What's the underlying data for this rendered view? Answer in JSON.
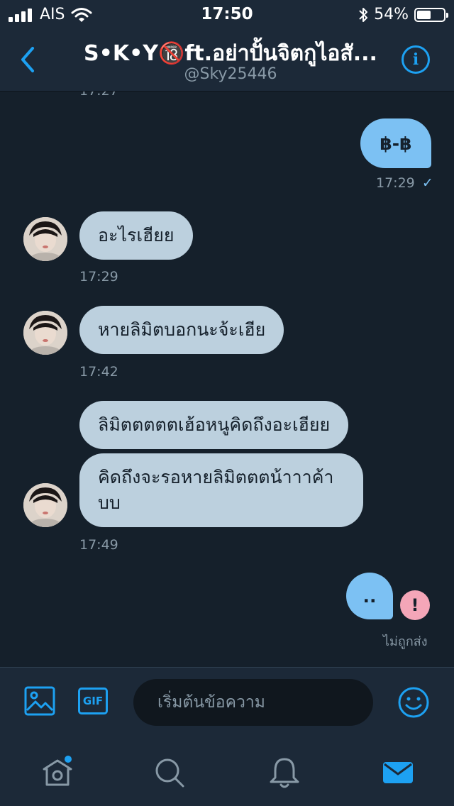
{
  "status_bar": {
    "carrier": "AIS",
    "time": "17:50",
    "battery_percent": "54%",
    "battery_level": 0.54
  },
  "header": {
    "title": "S•K•Y🔞ft.อย่าปั้นจิตกูไอสั...",
    "handle": "@Sky25446",
    "info_glyph": "i"
  },
  "conversation": {
    "top_timestamp": "17:27",
    "messages": [
      {
        "direction": "out",
        "text": "฿-฿",
        "time": "17:29",
        "status_glyph": "✓"
      },
      {
        "direction": "in",
        "text": "อะไรเฮียย",
        "time": "17:29"
      },
      {
        "direction": "in",
        "text": "หายลิมิตบอกนะจ้ะเฮีย",
        "time": "17:42"
      },
      {
        "direction": "in",
        "text": "ลิมิตตตตตเฮ้อหนูคิดถึงอะเฮียย",
        "time": ""
      },
      {
        "direction": "in",
        "text": "คิดถึงจะรอหายลิมิตตตน้าาาค้าบบ",
        "time": "17:49"
      },
      {
        "direction": "out",
        "text": "..",
        "error_glyph": "!",
        "status_text": "ไม่ถูกส่ง"
      }
    ]
  },
  "composer": {
    "gif_label": "GIF",
    "placeholder": "เริ่มต้นข้อความ"
  },
  "colors": {
    "accent": "#1da1f2",
    "background": "#15202b",
    "bar": "#1c2938",
    "outgoing_bubble": "#7cc1f3",
    "incoming_bubble": "#bcd0de",
    "error": "#f4a6b8"
  },
  "icons": {
    "back": "chevron-left-icon",
    "info": "info-icon",
    "image": "image-icon",
    "gif": "gif-icon",
    "emoji": "emoji-icon",
    "home": "home-icon",
    "search": "search-icon",
    "notifications": "bell-icon",
    "messages": "envelope-icon"
  }
}
